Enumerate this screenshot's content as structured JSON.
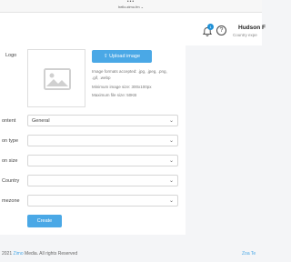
{
  "browser": {
    "menu_dots": "•••",
    "url": "hello.zimo.fm"
  },
  "header": {
    "notification_count": "1",
    "help_icon": "?",
    "user_name": "Hudson F",
    "user_subtitle": "Country expe"
  },
  "form": {
    "logo_label": "Logo",
    "upload_label": "Upload image",
    "hint_formats": "Image formats accepted: .jpg, .jpeg, .png,",
    "hint_formats_2": ".gif, .webp",
    "hint_min_size": "Minimum image size: 300x100px",
    "hint_max_file": "Maximum file size: 50KB",
    "fields": [
      {
        "label": "ontent",
        "value": "General"
      },
      {
        "label": "on type",
        "value": ""
      },
      {
        "label": "on size",
        "value": ""
      },
      {
        "label": "Country",
        "value": ""
      },
      {
        "label": "mezone",
        "value": ""
      }
    ],
    "create_label": "Create"
  },
  "footer": {
    "copyright": "2021 Zimo Media. All rights Reserved",
    "brand_link": "Zimo",
    "right_link": "Zoa Te"
  },
  "colors": {
    "accent": "#4aa8e6",
    "badge": "#1e90d6"
  }
}
